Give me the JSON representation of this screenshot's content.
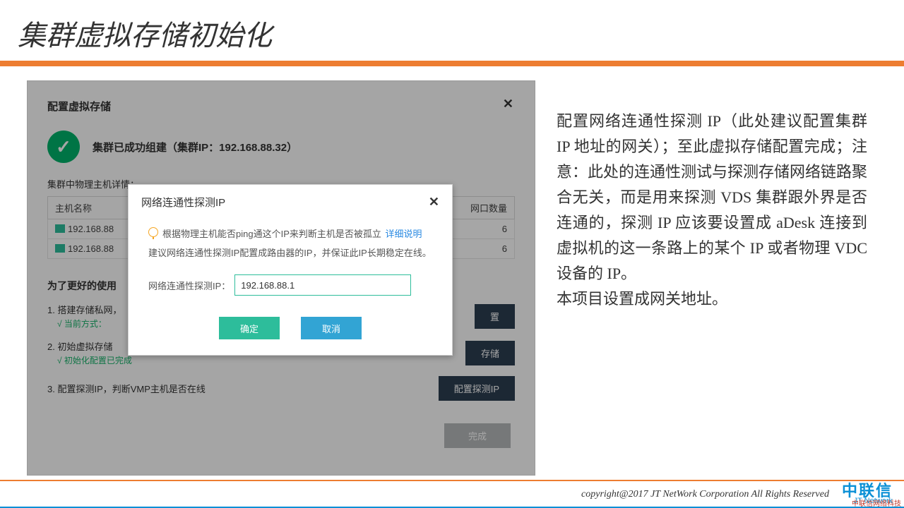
{
  "slide": {
    "title": "集群虚拟存储初始化"
  },
  "panel": {
    "title": "配置虚拟存储",
    "close_aria": "close",
    "success_text": "集群已成功组建（集群IP：192.168.88.32）",
    "subhead": "集群中物理主机详情：",
    "columns": {
      "host": "主机名称",
      "ports": "网口数量"
    },
    "rows": [
      {
        "host": "192.168.88",
        "ports": "6"
      },
      {
        "host": "192.168.88",
        "ports": "6"
      }
    ],
    "steps_title": "为了更好的使用",
    "step1": {
      "text": "1. 搭建存储私网，",
      "ok": "√ 当前方式：",
      "btn": "置"
    },
    "step2": {
      "text": "2. 初始虚拟存储",
      "ok": "√ 初始化配置已完成",
      "btn": "存储"
    },
    "step3": {
      "text": "3. 配置探测IP，判断VMP主机是否在线",
      "btn": "配置探测IP"
    },
    "done_btn": "完成"
  },
  "modal": {
    "title": "网络连通性探测IP",
    "hint1": "根据物理主机能否ping通这个IP来判断主机是否被孤立",
    "link": "详细说明",
    "hint2": "建议网络连通性探测IP配置成路由器的IP，并保证此IP长期稳定在线。",
    "field_label": "网络连通性探测IP：",
    "field_value": "192.168.88.1",
    "ok": "确定",
    "cancel": "取消"
  },
  "description": "配置网络连通性探测 IP（此处建议配置集群 IP 地址的网关）；至此虚拟存储配置完成；注意：此处的连通性测试与探测存储网络链路聚合无关，而是用来探测 VDS 集群跟外界是否连通的，探测 IP 应该要设置成 aDesk 连接到虚拟机的这一条路上的某个 IP 或者物理 VDC 设备的 IP。\n本项目设置成网关地址。",
  "footer": {
    "copyright": "copyright@2017  JT NetWork Corporation All Rights Reserved",
    "logo_big": "中联信",
    "logo_small": "JT Network",
    "tiny_red": "中联信网络科技"
  }
}
